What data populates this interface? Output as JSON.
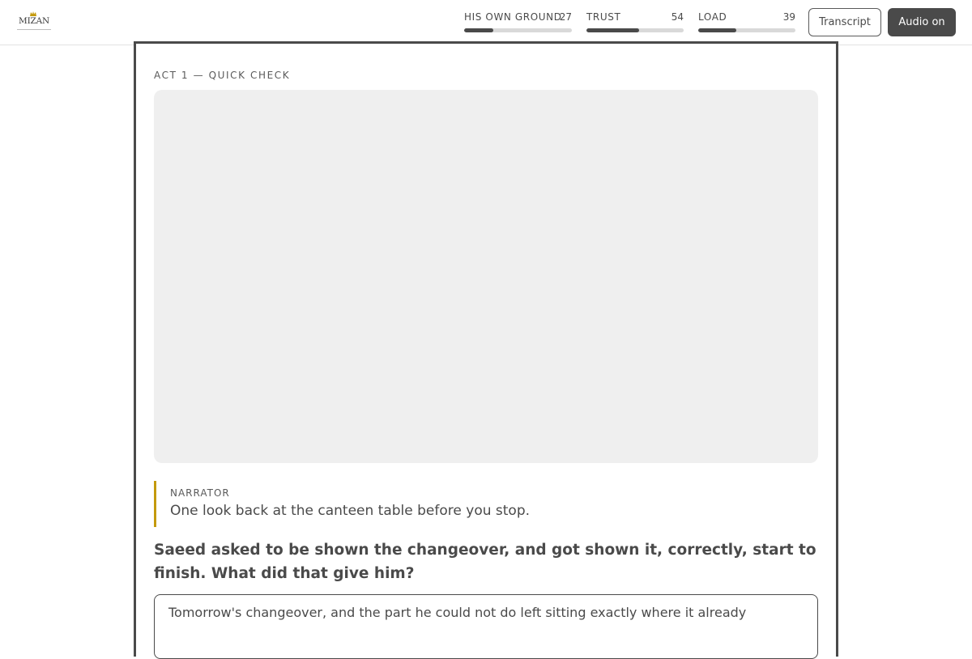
{
  "brand": {
    "logo_text": "MIZAN"
  },
  "meters": [
    {
      "label": "HIS OWN GROUND",
      "value": "27",
      "fraction": 0.27
    },
    {
      "label": "TRUST",
      "value": "54",
      "fraction": 0.54
    },
    {
      "label": "LOAD",
      "value": "39",
      "fraction": 0.39
    }
  ],
  "buttons": {
    "transcript": "Transcript",
    "audio": "Audio on"
  },
  "scene": {
    "act_label": "ACT 1 — QUICK CHECK",
    "narrator": {
      "speaker": "NARRATOR",
      "line": "One look back at the canteen table before you stop."
    },
    "question": "Saeed asked to be shown the changeover, and got shown it, correctly, start to finish. What did that give him?",
    "options": [
      "Tomorrow's changeover, and the part he could not do left sitting exactly where it already"
    ]
  },
  "colors": {
    "accent": "#c49a0c",
    "ink": "#4a4a4a",
    "media_bg": "#efefef"
  }
}
